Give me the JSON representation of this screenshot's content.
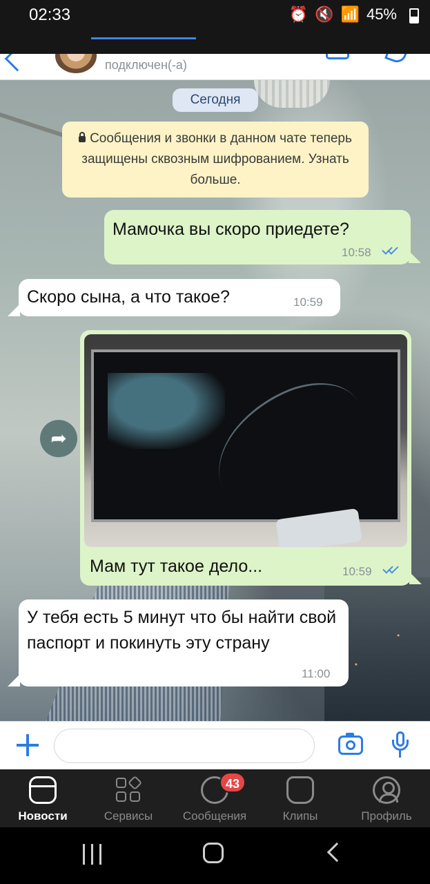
{
  "status_bar": {
    "time": "02:33",
    "battery": "45%"
  },
  "chat_header": {
    "status_text": "подключен(-а)"
  },
  "chat": {
    "date_label": "Сегодня",
    "encryption_notice": "Сообщения и звонки в данном чате теперь защищены сквозным шифрованием. Узнать больше.",
    "messages": [
      {
        "direction": "out",
        "text": "Мамочка вы скоро приедете?",
        "time": "10:58",
        "read": true
      },
      {
        "direction": "in",
        "text": "Скоро сына, а что такое?",
        "time": "10:59"
      },
      {
        "direction": "out",
        "type": "photo",
        "caption": "Мам тут такое дело...",
        "time": "10:59",
        "read": true
      },
      {
        "direction": "in",
        "text": "У тебя есть 5 минут что бы найти свой паспорт и покинуть эту страну",
        "time": "11:00"
      }
    ]
  },
  "input_bar": {
    "placeholder": "",
    "value": ""
  },
  "bottom_nav": {
    "items": [
      {
        "label": "Новости",
        "icon": "news-icon",
        "active": true
      },
      {
        "label": "Сервисы",
        "icon": "services-icon"
      },
      {
        "label": "Сообщения",
        "icon": "messages-icon",
        "badge": "43"
      },
      {
        "label": "Клипы",
        "icon": "clips-icon"
      },
      {
        "label": "Профиль",
        "icon": "profile-icon"
      }
    ]
  },
  "colors": {
    "accent": "#2c7be5",
    "outgoing_bubble": "#dcf4c8",
    "incoming_bubble": "#ffffff",
    "notice_bg": "#fdf3c6",
    "badge": "#e64646"
  }
}
